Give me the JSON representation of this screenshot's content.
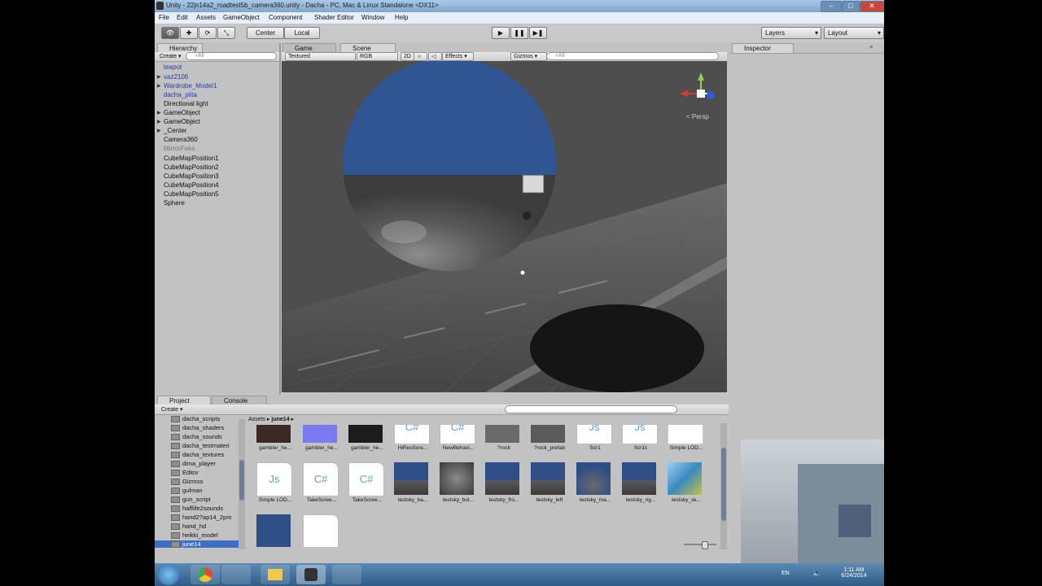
{
  "window": {
    "title": "Unity - 22jn14a2_roadtest5b_camera360.unity - Dacha - PC, Mac & Linux Standalone <DX11>"
  },
  "menu": [
    "File",
    "Edit",
    "Assets",
    "GameObject",
    "Component",
    "Shader Editor",
    "Window",
    "Help"
  ],
  "toolbar": {
    "pivot": "Center",
    "space": "Local",
    "layers": "Layers",
    "layout": "Layout",
    "play": "▶",
    "pause": "❚❚",
    "step": "▶❚"
  },
  "hierarchy": {
    "tab": "Hierarchy",
    "create": "Create ▾",
    "search_placeholder": "⌕All",
    "items": [
      {
        "label": "teapot",
        "expand": false
      },
      {
        "label": "vaz2106",
        "expand": true
      },
      {
        "label": "Wardrobe_Model1",
        "expand": true
      },
      {
        "label": "dacha_plita",
        "expand": false
      },
      {
        "label": "Directional light",
        "expand": false
      },
      {
        "label": "GameObject",
        "expand": true
      },
      {
        "label": "GameObject",
        "expand": true
      },
      {
        "label": "_Center",
        "expand": true
      },
      {
        "label": "Camera360",
        "expand": false
      },
      {
        "label": "MirrorFake",
        "expand": false
      },
      {
        "label": "CubeMapPosition1",
        "expand": false
      },
      {
        "label": "CubeMapPosition2",
        "expand": false
      },
      {
        "label": "CubeMapPosition3",
        "expand": false
      },
      {
        "label": "CubeMapPosition4",
        "expand": false
      },
      {
        "label": "CubeMapPosition5",
        "expand": false
      },
      {
        "label": "Sphere",
        "expand": false
      }
    ]
  },
  "scene": {
    "tab_game": "Game",
    "tab_scene": "Scene",
    "render_mode": "Textured",
    "color_mode": "RGB",
    "toggle_2d": "2D",
    "effects": "Effects ▾",
    "gizmos": "Gizmos ▾",
    "search_placeholder": "⌕All",
    "persp": "< Persp"
  },
  "inspector": {
    "tab": "Inspector"
  },
  "project": {
    "tab_project": "Project",
    "tab_console": "Console",
    "create": "Create ▾",
    "breadcrumb": [
      "Assets",
      "june14"
    ],
    "folders": [
      "dacha_scripts",
      "dacha_shaders",
      "dacha_sounds",
      "dacha_testmateri",
      "dacha_textures",
      "dima_player",
      "Editor",
      "Gizmos",
      "gulman",
      "gun_script",
      "halflife2sounds",
      "hand2?ap14_2pm",
      "hand_hd",
      "heikki_model",
      "june14"
    ],
    "assets_row1": [
      "gambler_he...",
      "gambler_he...",
      "gambler_he...",
      "HiResScre...",
      "NewBehavi...",
      "?rock",
      "?rock_prefab",
      "Scr1",
      "Scr1c",
      "Simple LOD..."
    ],
    "assets_row2": [
      "Simple LOD...",
      "TakeScree...",
      "TakeScree...",
      "testsky_ba...",
      "testsky_bot...",
      "testsky_fro...",
      "testsky_left",
      "testsky_ma...",
      "testsky_rig...",
      "testsky_sk..."
    ],
    "assets_row3": [
      "",
      ""
    ]
  },
  "taskbar": {
    "time": "1:11 AM",
    "date": "6/24/2014",
    "lang": "EN"
  }
}
